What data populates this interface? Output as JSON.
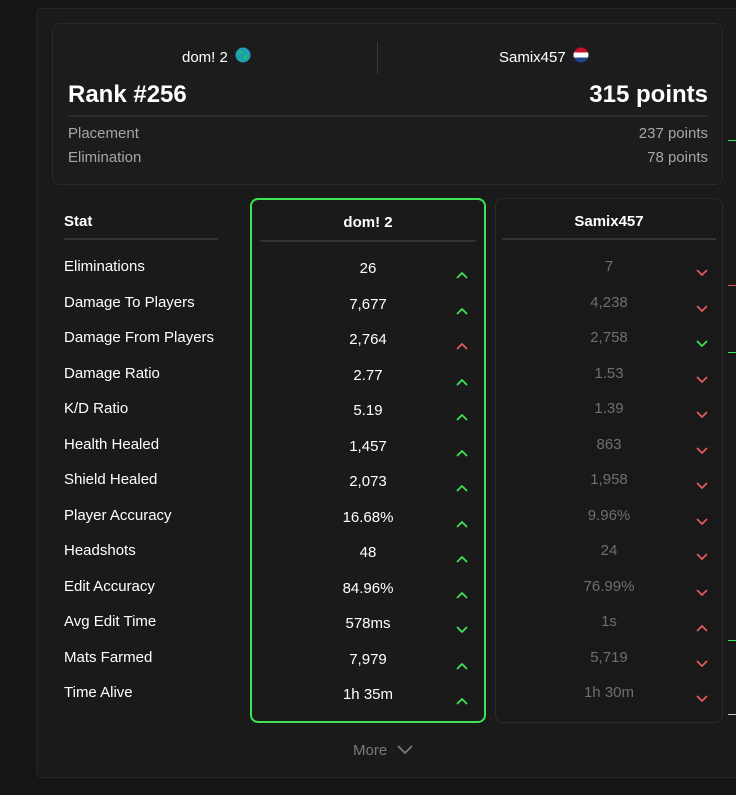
{
  "header": {
    "player1": {
      "name": "dom! 2",
      "flag": "globe-icon"
    },
    "player2": {
      "name": "Samix457",
      "flag": "netherlands-flag-icon"
    },
    "rank": "Rank #256",
    "total_points": "315 points",
    "placement_label": "Placement",
    "placement_value": "237 points",
    "elimination_label": "Elimination",
    "elimination_value": "78 points"
  },
  "table": {
    "stat_header": "Stat",
    "p1_header": "dom! 2",
    "p2_header": "Samix457",
    "rows": [
      {
        "label": "Eliminations",
        "p1": "26",
        "p1_trend": "up-green",
        "p2": "7",
        "p2_trend": "down-red"
      },
      {
        "label": "Damage To Players",
        "p1": "7,677",
        "p1_trend": "up-green",
        "p2": "4,238",
        "p2_trend": "down-red"
      },
      {
        "label": "Damage From Players",
        "p1": "2,764",
        "p1_trend": "up-red",
        "p2": "2,758",
        "p2_trend": "down-green"
      },
      {
        "label": "Damage Ratio",
        "p1": "2.77",
        "p1_trend": "up-green",
        "p2": "1.53",
        "p2_trend": "down-red"
      },
      {
        "label": "K/D Ratio",
        "p1": "5.19",
        "p1_trend": "up-green",
        "p2": "1.39",
        "p2_trend": "down-red"
      },
      {
        "label": "Health Healed",
        "p1": "1,457",
        "p1_trend": "up-green",
        "p2": "863",
        "p2_trend": "down-red"
      },
      {
        "label": "Shield Healed",
        "p1": "2,073",
        "p1_trend": "up-green",
        "p2": "1,958",
        "p2_trend": "down-red"
      },
      {
        "label": "Player Accuracy",
        "p1": "16.68%",
        "p1_trend": "up-green",
        "p2": "9.96%",
        "p2_trend": "down-red"
      },
      {
        "label": "Headshots",
        "p1": "48",
        "p1_trend": "up-green",
        "p2": "24",
        "p2_trend": "down-red"
      },
      {
        "label": "Edit Accuracy",
        "p1": "84.96%",
        "p1_trend": "up-green",
        "p2": "76.99%",
        "p2_trend": "down-red"
      },
      {
        "label": "Avg Edit Time",
        "p1": "578ms",
        "p1_trend": "down-green",
        "p2": "1s",
        "p2_trend": "up-red"
      },
      {
        "label": "Mats Farmed",
        "p1": "7,979",
        "p1_trend": "up-green",
        "p2": "5,719",
        "p2_trend": "down-red"
      },
      {
        "label": "Time Alive",
        "p1": "1h 35m",
        "p1_trend": "up-green",
        "p2": "1h 30m",
        "p2_trend": "down-red"
      }
    ]
  },
  "more_label": "More",
  "colors": {
    "accent_green": "#3ee255",
    "trend_red": "#e05a5a",
    "muted": "#6f6f6f"
  }
}
